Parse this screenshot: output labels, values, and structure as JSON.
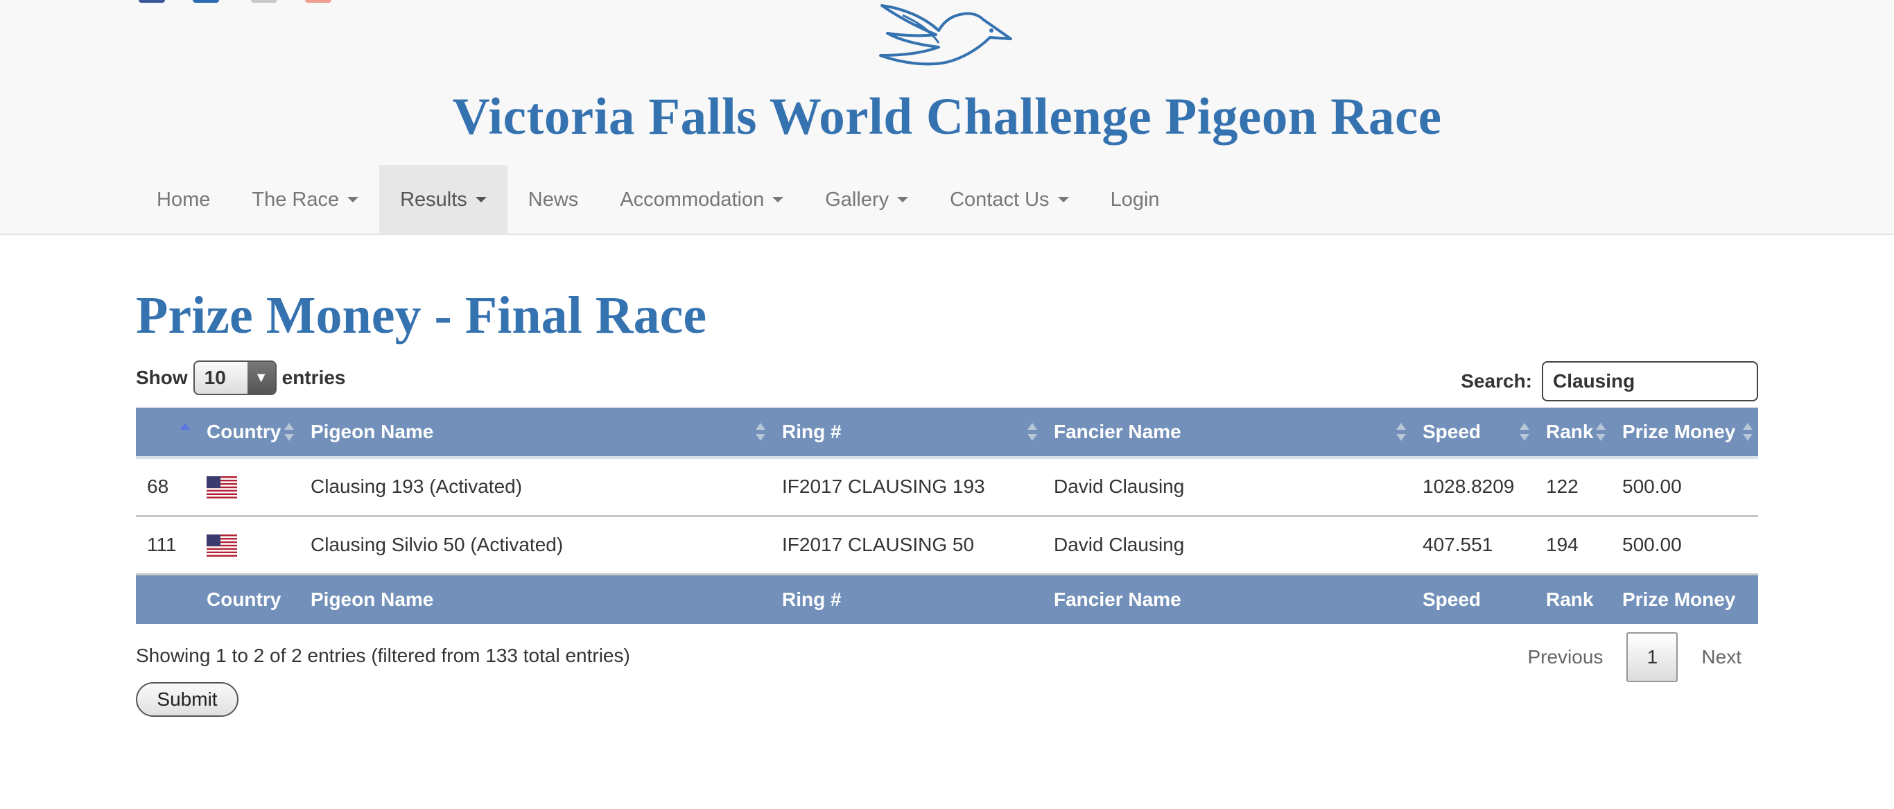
{
  "site": {
    "title": "Victoria Falls World Challenge Pigeon Race"
  },
  "nav": {
    "items": [
      {
        "label": "Home"
      },
      {
        "label": "The Race"
      },
      {
        "label": "Results"
      },
      {
        "label": "News"
      },
      {
        "label": "Accommodation"
      },
      {
        "label": "Gallery"
      },
      {
        "label": "Contact Us"
      },
      {
        "label": "Login"
      }
    ],
    "active": "Results"
  },
  "page": {
    "title": "Prize Money - Final Race"
  },
  "length": {
    "show_label": "Show",
    "value": "10",
    "entries_label": "entries"
  },
  "search": {
    "label": "Search:",
    "value": "Clausing"
  },
  "table": {
    "headers": [
      "",
      "Country",
      "Pigeon Name",
      "Ring #",
      "Fancier Name",
      "Speed",
      "Rank",
      "Prize Money"
    ],
    "rows": [
      {
        "num": "68",
        "country_icon": "us-flag-icon",
        "pigeon": "Clausing 193 (Activated)",
        "ring": "IF2017 CLAUSING 193",
        "fancier": "David Clausing",
        "speed": "1028.8209",
        "rank": "122",
        "prize": "500.00"
      },
      {
        "num": "111",
        "country_icon": "us-flag-icon",
        "pigeon": "Clausing Silvio 50 (Activated)",
        "ring": "IF2017 CLAUSING 50",
        "fancier": "David Clausing",
        "speed": "407.551",
        "rank": "194",
        "prize": "500.00"
      }
    ]
  },
  "info": "Showing 1 to 2 of 2 entries (filtered from 133 total entries)",
  "pagination": {
    "previous": "Previous",
    "current": "1",
    "next": "Next"
  },
  "submit_label": "Submit",
  "colors": {
    "brand_blue": "#3572b0",
    "table_header": "#7290b9",
    "nav_active_bg": "#e7e7e7"
  }
}
